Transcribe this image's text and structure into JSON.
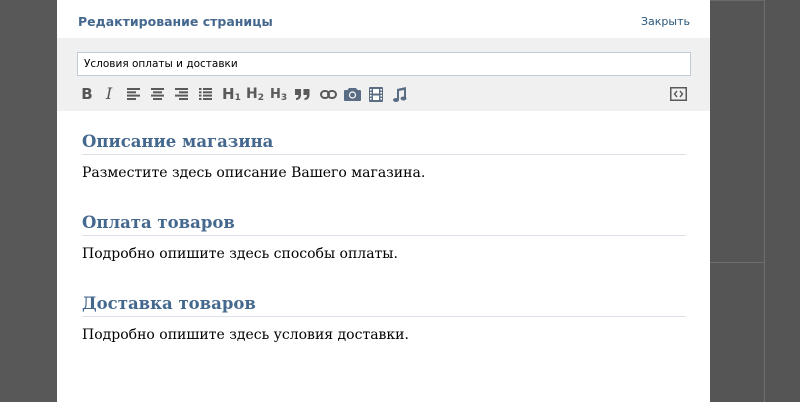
{
  "dialog": {
    "title": "Редактирование страницы",
    "close_label": "Закрыть"
  },
  "editor": {
    "page_title_value": "Условия оплаты и доставки",
    "toolbar": {
      "bold": "B",
      "italic": "I",
      "h1": "H",
      "h2": "H",
      "h3": "H",
      "sub1": "1",
      "sub2": "2",
      "sub3": "3",
      "quote": "❞"
    }
  },
  "content": {
    "sections": [
      {
        "heading": "Описание магазина",
        "text": "Разместите здесь описание Вашего магазина."
      },
      {
        "heading": "Оплата товаров",
        "text": "Подробно опишите здесь способы оплаты."
      },
      {
        "heading": "Доставка товаров",
        "text": "Подробно опишите здесь условия доставки."
      }
    ]
  },
  "colors": {
    "accent": "#45688e",
    "link": "#2b587a",
    "toolbar_bg": "#f0f0f0",
    "overlay": "#585858"
  },
  "icons": [
    "bold-icon",
    "italic-icon",
    "align-left-icon",
    "align-center-icon",
    "align-right-icon",
    "list-icon",
    "heading1-icon",
    "heading2-icon",
    "heading3-icon",
    "quote-icon",
    "link-icon",
    "photo-icon",
    "video-icon",
    "audio-icon",
    "wiki-markup-icon"
  ]
}
